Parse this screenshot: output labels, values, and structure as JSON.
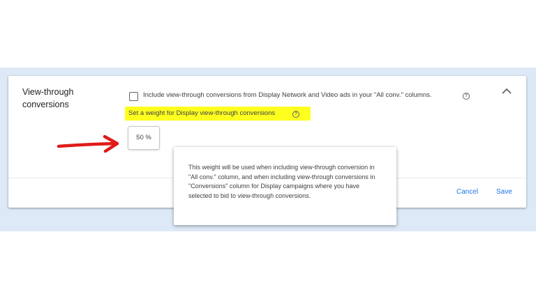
{
  "section": {
    "title": "View-through conversions"
  },
  "include_option": {
    "label": "Include view-through conversions from Display Network and Video ads in your \"All conv.\" columns.",
    "checked": false
  },
  "weight": {
    "label": "Set a weight for Display view-through conversions",
    "value": "50 %"
  },
  "tooltip": {
    "text": "This weight will be used when including view-through conversion in \"All conv.\" column, and when including view-through conversions in \"Conversions\" column for Display campaigns where you have selected to bid to view-through conversions."
  },
  "actions": {
    "cancel_label": "Cancel",
    "save_label": "Save"
  },
  "icons": {
    "help": "help-circle-icon",
    "collapse": "chevron-up-icon",
    "annotation": "red-arrow"
  },
  "colors": {
    "accent": "#1a73e8",
    "highlight": "#ffff1f",
    "band": "#dde9f7",
    "annotation": "#e01b1b"
  }
}
